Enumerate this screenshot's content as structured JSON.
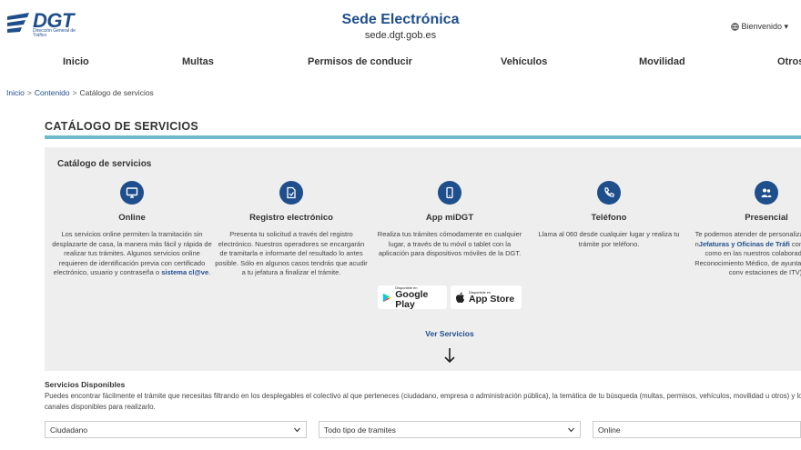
{
  "header": {
    "logo_text": "DGT",
    "logo_sub": "Dirección General de Tráfico",
    "title": "Sede Electrónica",
    "url": "sede.dgt.gob.es",
    "welcome": "Bienvenido ▾"
  },
  "nav": {
    "items": [
      {
        "label": "Inicio"
      },
      {
        "label": "Multas"
      },
      {
        "label": "Permisos de conducir"
      },
      {
        "label": "Vehículos"
      },
      {
        "label": "Movilidad"
      },
      {
        "label": "Otros"
      }
    ]
  },
  "breadcrumb": {
    "items": [
      "Inicio",
      "Contenido",
      "Catálogo de servicios"
    ],
    "separator": ">"
  },
  "page": {
    "title": "CATÁLOGO DE SERVICIOS",
    "accent_color": "#6fb9cd",
    "brand_color": "#1f4e8c"
  },
  "catalog": {
    "title": "Catálogo de servicios",
    "services": [
      {
        "icon": "monitor-icon",
        "name": "Online",
        "desc_a": "Los servicios online permiten la tramitación sin desplazarte de casa, la manera más fácil y rápida de realizar tus trámites. Algunos servicios online requieren de identificación previa con certificado electrónico, usuario y contraseña o ",
        "desc_link": "sistema cl@ve",
        "desc_b": "."
      },
      {
        "icon": "document-icon",
        "name": "Registro electrónico",
        "desc_a": "Presenta tu solicitud a través del registro electrónico. Nuestros operadores se encargarán de tramitarla e informarte del resultado lo antes posible. Sólo en algunos casos tendrás que acudir a tu jefatura a finalizar el trámite.",
        "desc_link": "",
        "desc_b": ""
      },
      {
        "icon": "mobile-app-icon",
        "name": "App miDGT",
        "desc_a": "Realiza tus trámites cómodamente en cualquier lugar, a través de tu móvil o tablet con la aplicación para dispositivos móviles de la DGT.",
        "desc_link": "",
        "desc_b": ""
      },
      {
        "icon": "phone-icon",
        "name": "Teléfono",
        "desc_a": "Llama al 060 desde cualquier lugar y realiza tu trámite por teléfono.",
        "desc_link": "",
        "desc_b": ""
      },
      {
        "icon": "people-icon",
        "name": "Presencial",
        "desc_a": "Te podemos atender de personalizada tanto en n",
        "desc_link": "Jefaturas y Oficinas de Tráfi",
        "desc_b": " con cita previa, como en las nuestros colaboradores (Ce Reconocimiento Médico, de ayuntamientos con conv estaciones de ITV)."
      }
    ],
    "stores": [
      {
        "small": "Disponible en",
        "big": "Google Play"
      },
      {
        "small": "Disponible en",
        "big": "App Store"
      }
    ],
    "ver_servicios": "Ver Servicios"
  },
  "available": {
    "title": "Servicios Disponibles",
    "text": "Puedes encontrar fácilmente el trámite que necesitas filtrando en los desplegables el colectivo al que perteneces (ciudadano, empresa o administración pública), la temática de tu búsqueda (multas, permisos, vehículos, movilidad u otros) y los canales disponibles para realizarlo.",
    "filters": [
      {
        "value": "Ciudadano"
      },
      {
        "value": "Todo tipo de tramites"
      },
      {
        "value": "Online"
      }
    ]
  }
}
